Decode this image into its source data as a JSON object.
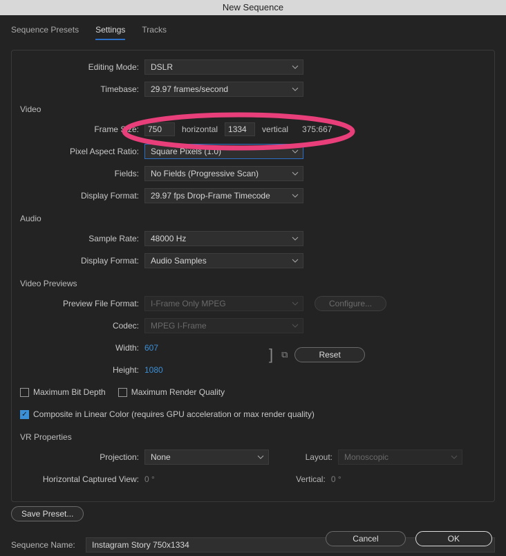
{
  "title": "New Sequence",
  "tabs": {
    "presets": "Sequence Presets",
    "settings": "Settings",
    "tracks": "Tracks"
  },
  "editing": {
    "mode_label": "Editing Mode:",
    "mode_value": "DSLR",
    "timebase_label": "Timebase:",
    "timebase_value": "29.97  frames/second"
  },
  "video": {
    "title": "Video",
    "frame_label": "Frame Size:",
    "h_value": "750",
    "h_label": "horizontal",
    "v_value": "1334",
    "v_label": "vertical",
    "ratio": "375:667",
    "par_label": "Pixel Aspect Ratio:",
    "par_value": "Square Pixels (1.0)",
    "fields_label": "Fields:",
    "fields_value": "No Fields (Progressive Scan)",
    "dispfmt_label": "Display Format:",
    "dispfmt_value": "29.97 fps Drop-Frame Timecode"
  },
  "audio": {
    "title": "Audio",
    "rate_label": "Sample Rate:",
    "rate_value": "48000 Hz",
    "dispfmt_label": "Display Format:",
    "dispfmt_value": "Audio Samples"
  },
  "previews": {
    "title": "Video Previews",
    "pff_label": "Preview File Format:",
    "pff_value": "I-Frame Only MPEG",
    "configure": "Configure...",
    "codec_label": "Codec:",
    "codec_value": "MPEG I-Frame",
    "width_label": "Width:",
    "width_value": "607",
    "height_label": "Height:",
    "height_value": "1080",
    "reset": "Reset",
    "max_bit": "Maximum Bit Depth",
    "max_render": "Maximum Render Quality",
    "composite": "Composite in Linear Color (requires GPU acceleration or max render quality)"
  },
  "vr": {
    "title": "VR Properties",
    "proj_label": "Projection:",
    "proj_value": "None",
    "layout_label": "Layout:",
    "layout_value": "Monoscopic",
    "hcv_label": "Horizontal Captured View:",
    "hcv_value": "0 °",
    "vert_label": "Vertical:",
    "vert_value": "0 °"
  },
  "save_preset": "Save Preset...",
  "seqname_label": "Sequence Name:",
  "seqname_value": "Instagram Story 750x1334",
  "cancel": "Cancel",
  "ok": "OK"
}
